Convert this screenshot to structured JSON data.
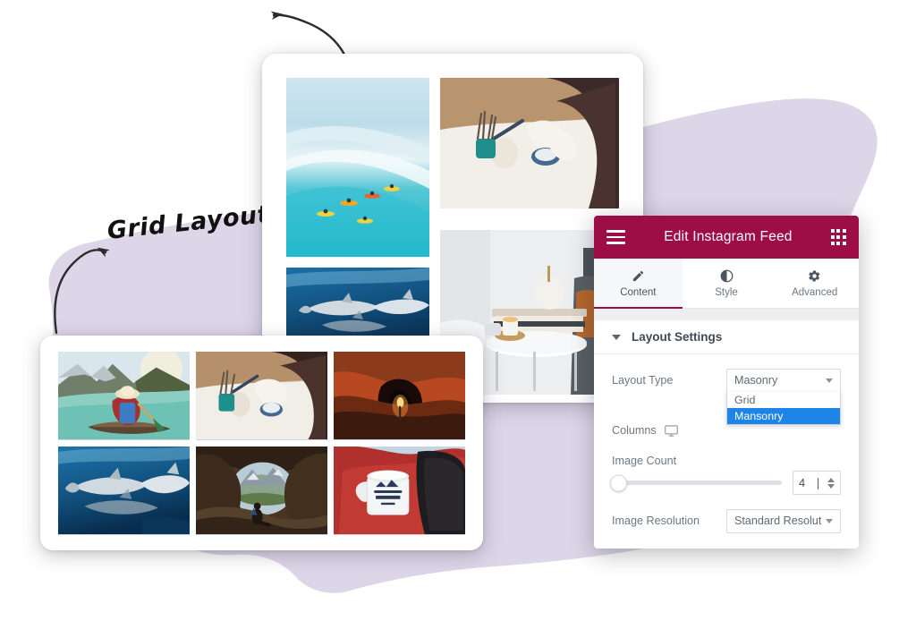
{
  "annotation": {
    "text": "Grid Layout",
    "arrow_to_annotation": "curved-arrow-icon",
    "arrow_to_masonry_card": "curved-arrow-icon"
  },
  "colors": {
    "brand_magenta": "#9d0e46",
    "blob_lavender": "#ddd5e8",
    "highlight_blue": "#1e85e8",
    "label_gray": "#6d7882"
  },
  "panel": {
    "header": {
      "title": "Edit Instagram Feed",
      "menu_icon": "hamburger-icon",
      "apps_icon": "apps-grid-icon"
    },
    "tabs": [
      {
        "label": "Content",
        "icon": "pencil-icon",
        "active": true
      },
      {
        "label": "Style",
        "icon": "contrast-icon",
        "active": false
      },
      {
        "label": "Advanced",
        "icon": "gear-icon",
        "active": false
      }
    ],
    "section": {
      "title": "Layout Settings",
      "collapse_icon": "caret-down-icon"
    },
    "fields": {
      "layout_type": {
        "label": "Layout Type",
        "value": "Masonry",
        "dropdown_open": true,
        "options": [
          {
            "label": "Grid",
            "selected": false
          },
          {
            "label": "Mansonry",
            "selected": true
          }
        ]
      },
      "columns": {
        "label": "Columns",
        "device_icon": "desktop-monitor-icon"
      },
      "image_count": {
        "label": "Image Count",
        "value": "4",
        "slider_percent": 0
      },
      "image_resolution": {
        "label": "Image Resolution",
        "value": "Standard Resolutio"
      }
    }
  },
  "cards": {
    "masonry": {
      "name": "Masonry layout preview",
      "images": [
        {
          "alt": "surfers riding a large turquoise wave"
        },
        {
          "alt": "woman painting a ceramic pot at a desk"
        },
        {
          "alt": "dolphins swimming underwater"
        },
        {
          "alt": "white side table with candle and books"
        }
      ]
    },
    "grid": {
      "name": "Grid layout preview",
      "images": [
        {
          "alt": "woman paddling a canoe on a mountain lake"
        },
        {
          "alt": "woman painting a ceramic pot"
        },
        {
          "alt": "person with torch inside a red cave"
        },
        {
          "alt": "dolphins swimming underwater"
        },
        {
          "alt": "person sitting in a cave opening over a valley"
        },
        {
          "alt": "hands holding an Adventure Begins enamel mug"
        }
      ]
    }
  }
}
